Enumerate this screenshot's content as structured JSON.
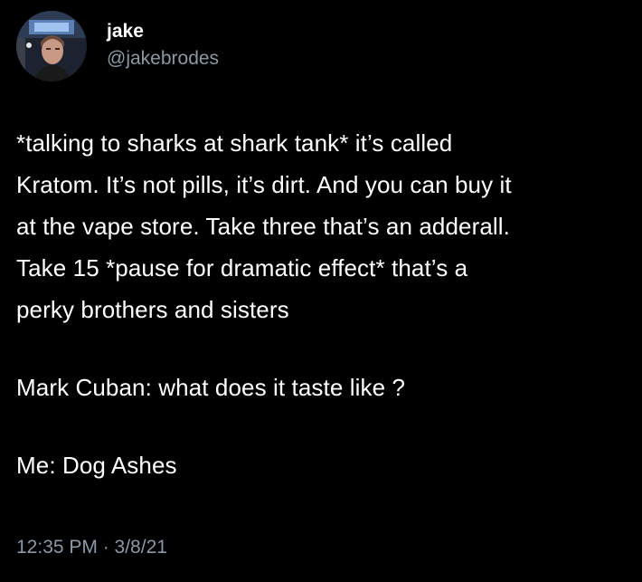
{
  "author": {
    "display_name": "jake",
    "handle": "@jakebrodes",
    "avatar_icon": "profile-photo"
  },
  "tweet": {
    "paragraph_1": {
      "line_1": "*talking to sharks at shark tank* it’s called",
      "line_2": "Kratom. It’s not pills, it’s dirt. And you can buy it",
      "line_3": "at the vape store. Take three that’s an adderall.",
      "line_4": "Take 15 *pause for dramatic effect* that’s a",
      "line_5": "perky brothers and sisters"
    },
    "paragraph_2": "Mark Cuban: what does it taste like ?",
    "paragraph_3": "Me: Dog Ashes"
  },
  "meta": {
    "timestamp": "12:35 PM · 3/8/21"
  },
  "colors": {
    "background": "#000000",
    "primary_text": "#ffffff",
    "secondary_text": "#8b98a5"
  }
}
